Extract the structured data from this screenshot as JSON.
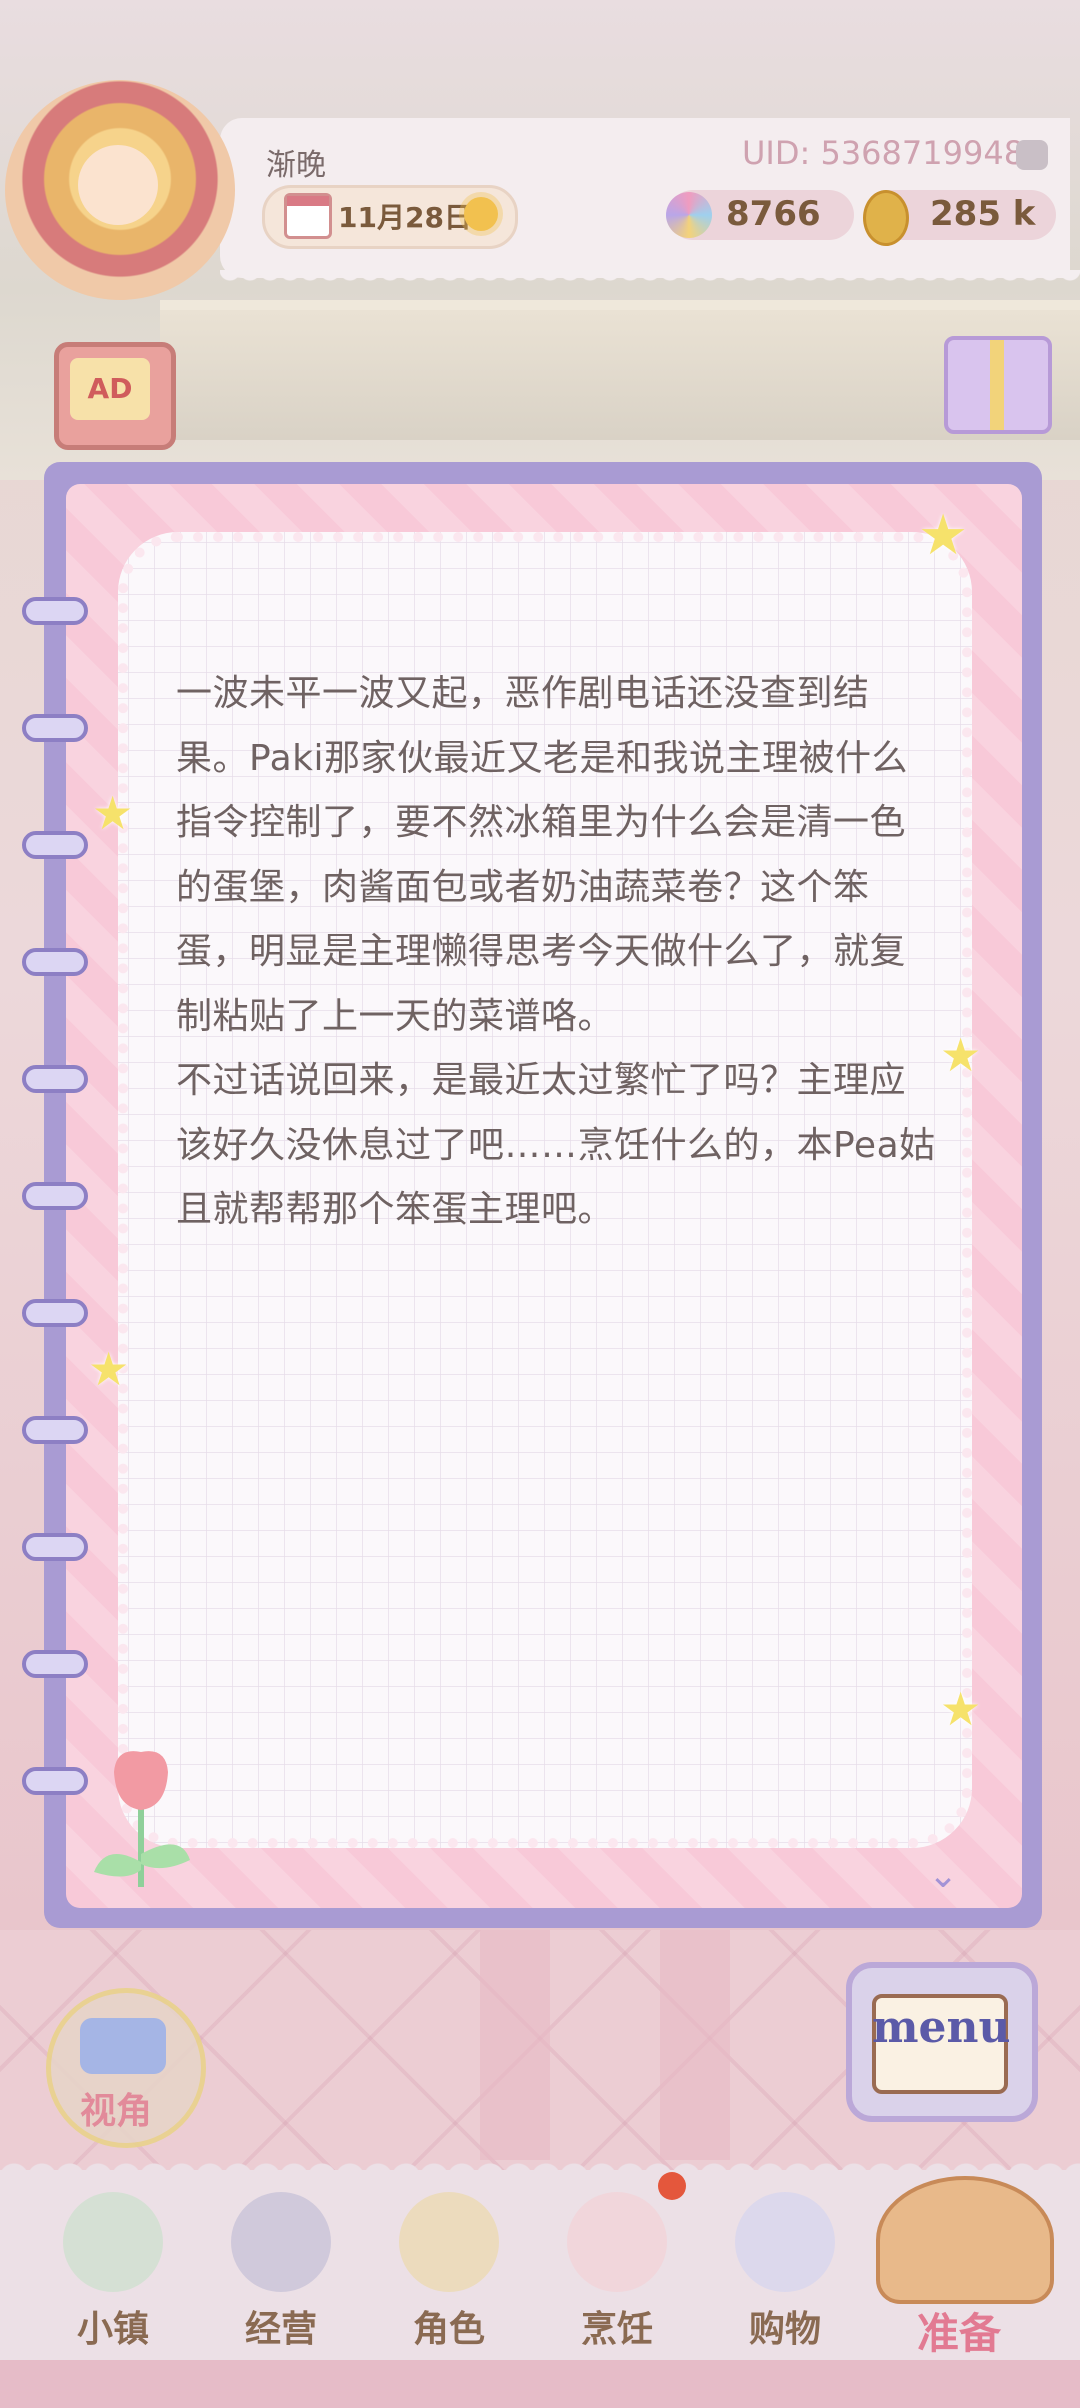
{
  "header": {
    "player_name": "渐晚",
    "date": "11月28日",
    "uid": "UID: 5368719948",
    "gems": "8766",
    "coins": "285 k"
  },
  "ad_button": {
    "label": "AD"
  },
  "note": {
    "paragraphs": [
      "一波未平一波又起，恶作剧电话还没查到结果。Paki那家伙最近又老是和我说主理被什么指令控制了，要不然冰箱里为什么会是清一色的蛋堡，肉酱面包或者奶油蔬菜卷？这个笨蛋，明显是主理懒得思考今天做什么了，就复制粘贴了上一天的菜谱咯。",
      "不过话说回来，是最近太过繁忙了吗？主理应该好久没休息过了吧……烹饪什么的，本Pea姑且就帮帮那个笨蛋主理吧。"
    ]
  },
  "view_button": {
    "label": "视角"
  },
  "menu_button": {
    "label": "menu"
  },
  "bottom_nav": {
    "items": [
      {
        "label": "小镇",
        "icon": "map-icon"
      },
      {
        "label": "经营",
        "icon": "bag-icon"
      },
      {
        "label": "角色",
        "icon": "character-icon"
      },
      {
        "label": "烹饪",
        "icon": "dish-icon"
      },
      {
        "label": "购物",
        "icon": "shopping-bag-icon"
      },
      {
        "label": "准备",
        "icon": "basket-icon"
      }
    ],
    "active": "准备"
  },
  "colors": {
    "notebook_frame": "#a99bd3",
    "notebook_page": "#f8c9d8",
    "text": "#6f6262",
    "active_nav": "#e27a92",
    "badge": "#e4573c"
  }
}
